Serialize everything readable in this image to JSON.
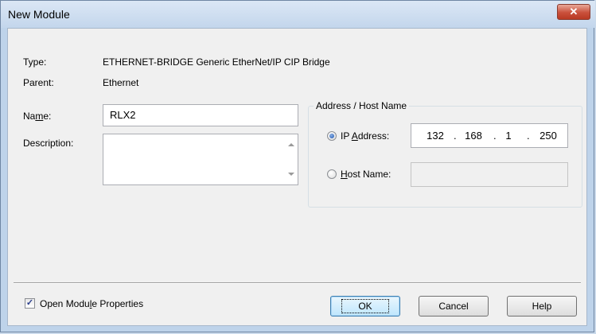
{
  "window": {
    "title": "New Module",
    "close_glyph": "✕"
  },
  "fields": {
    "type_label": "Type:",
    "type_value": "ETHERNET-BRIDGE Generic EtherNet/IP CIP Bridge",
    "parent_label": "Parent:",
    "parent_value": "Ethernet",
    "name_label_pre": "Na",
    "name_label_mnemonic": "m",
    "name_label_post": "e:",
    "name_value": "RLX2",
    "description_label": "Description:",
    "description_value": ""
  },
  "address_group": {
    "legend": "Address / Host Name",
    "ip_option_pre": "IP ",
    "ip_option_mnemonic": "A",
    "ip_option_post": "ddress:",
    "ip_selected": true,
    "ip_octets": [
      "132",
      "168",
      "1",
      "250"
    ],
    "host_option_mnemonic": "H",
    "host_option_post": "ost Name:",
    "host_value": ""
  },
  "footer": {
    "open_props_pre": "Open Modu",
    "open_props_mnemonic": "l",
    "open_props_post": "e Properties",
    "open_props_checked": true,
    "ok_label": "OK",
    "cancel_label": "Cancel",
    "help_label": "Help"
  }
}
